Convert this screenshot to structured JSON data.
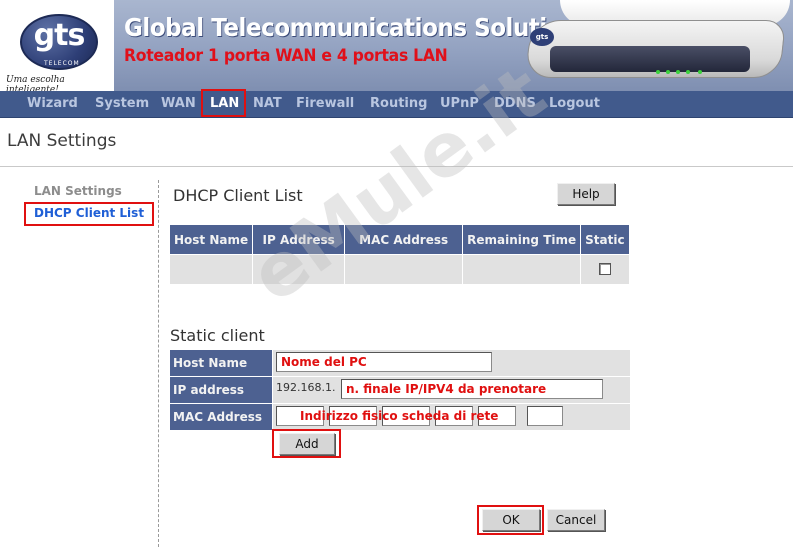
{
  "banner": {
    "logo_text": "gts",
    "logo_subtext": "TELECOM",
    "tagline": "Uma escolha inteligente!",
    "title": "Global Telecommunications Solutions",
    "subtitle": "Roteador 1 porta WAN e 4 portas LAN",
    "device_badge": "gts"
  },
  "nav": {
    "items": [
      "Wizard",
      "System",
      "WAN",
      "LAN",
      "NAT",
      "Firewall",
      "Routing",
      "UPnP",
      "DDNS",
      "Logout"
    ],
    "active": "LAN"
  },
  "page": {
    "title": "LAN Settings"
  },
  "sidebar": {
    "items": [
      {
        "label": "LAN Settings",
        "selected": false
      },
      {
        "label": "DHCP Client List",
        "selected": true
      }
    ]
  },
  "dhcp": {
    "title": "DHCP Client List",
    "help_label": "Help",
    "columns": [
      "Host Name",
      "IP Address",
      "MAC Address",
      "Remaining Time",
      "Static"
    ]
  },
  "static_client": {
    "title": "Static client",
    "host_label": "Host Name",
    "host_value": "Nome del PC",
    "ip_label": "IP address",
    "ip_prefix": "192.168.1.",
    "ip_value": "n. finale IP/IPV4 da prenotare",
    "mac_label": "MAC Address",
    "mac_value": "Indirizzo fisico scheda di rete",
    "add_label": "Add"
  },
  "footer": {
    "ok_label": "OK",
    "cancel_label": "Cancel"
  },
  "watermark": "eMule.it",
  "colors": {
    "nav_bg": "#415a8c",
    "table_header": "#4d6191",
    "highlight": "#e01010",
    "link": "#1f5fd6"
  }
}
